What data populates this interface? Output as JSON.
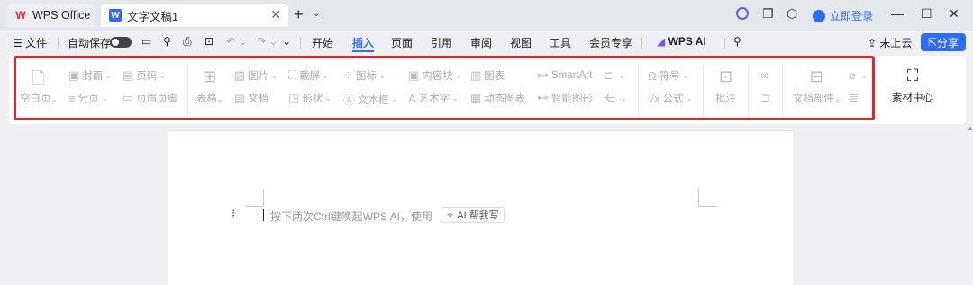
{
  "titlebar": {
    "tabs": [
      {
        "label": "WPS Office",
        "logo": "W"
      },
      {
        "label": "文字文稿1",
        "logo": "W"
      }
    ],
    "login_label": "立即登录"
  },
  "menubar": {
    "file": "文件",
    "autosave": "自动保存",
    "tabs": [
      "开始",
      "插入",
      "页面",
      "引用",
      "审阅",
      "视图",
      "工具",
      "会员专享"
    ],
    "active_tab": "插入",
    "wps_ai": "WPS AI",
    "cloud": "未上云",
    "share": "分享"
  },
  "ribbon": {
    "blank_page": "空白页",
    "cover": "封面",
    "page_break": "分页",
    "page_num": "页码",
    "header_footer": "页眉页脚",
    "table": "表格",
    "picture": "图片",
    "document": "文档",
    "screenshot": "截屏",
    "shape": "形状",
    "icon": "图标",
    "textbox": "文本框",
    "content_block": "内容块",
    "art_text": "艺术字",
    "chart": "图表",
    "dynamic_chart": "动态图表",
    "smartart": "SmartArt",
    "smart_graphic": "智能图形",
    "symbol": "符号",
    "formula": "公式",
    "comment": "批注",
    "doc_parts": "文档部件",
    "material": "素材中心"
  },
  "document": {
    "hint": "按下两次Ctrl键唤起WPS AI，使用",
    "ai_button": "AI 帮我写"
  },
  "colors": {
    "accent": "#2f6cf6",
    "highlight": "#e5222f"
  }
}
